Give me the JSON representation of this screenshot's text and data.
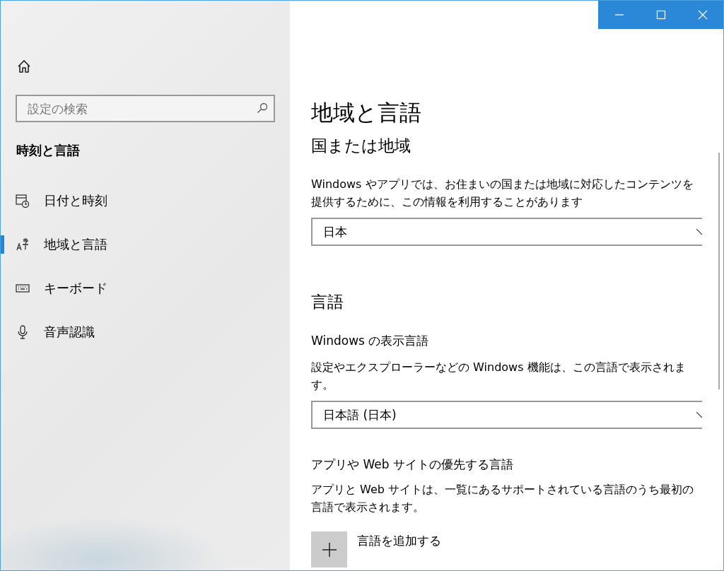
{
  "sidebar": {
    "search": {
      "placeholder": "設定の検索"
    },
    "section_title": "時刻と言語",
    "items": [
      {
        "label": "日付と時刻",
        "selected": false
      },
      {
        "label": "地域と言語",
        "selected": true
      },
      {
        "label": "キーボード",
        "selected": false
      },
      {
        "label": "音声認識",
        "selected": false
      }
    ]
  },
  "main": {
    "title": "地域と言語",
    "region": {
      "heading": "国または地域",
      "description": "Windows やアプリでは、お住まいの国または地域に対応したコンテンツを提供するために、この情報を利用することがあります",
      "dropdown": {
        "value": "日本"
      }
    },
    "language": {
      "heading": "言語",
      "display_language": {
        "label": "Windows の表示言語",
        "description": "設定やエクスプローラーなどの Windows 機能は、この言語で表示されます。",
        "dropdown": {
          "value": "日本語 (日本)"
        }
      },
      "preferred": {
        "label": "アプリや Web サイトの優先する言語",
        "description": "アプリと Web サイトは、一覧にあるサポートされている言語のうち最初の言語で表示されます。",
        "add_button": {
          "label": "言語を追加する"
        }
      }
    }
  }
}
